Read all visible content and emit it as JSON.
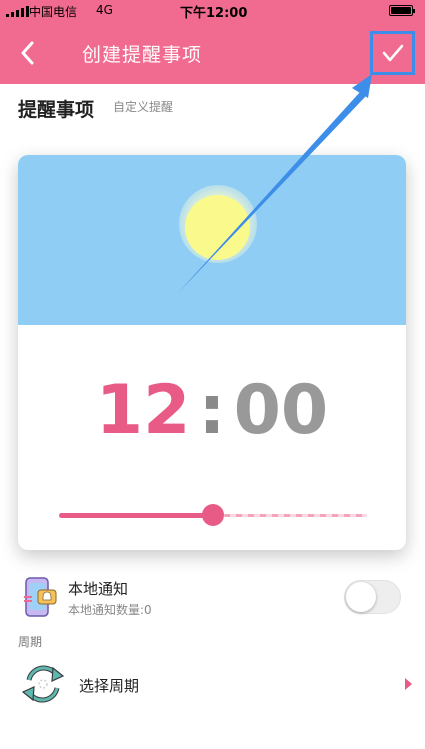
{
  "status_bar": {
    "carrier": "中国电信",
    "network": "4G",
    "time": "下午12:00"
  },
  "nav": {
    "title": "创建提醒事项",
    "back_icon": "chevron-left-icon",
    "confirm_icon": "check-icon"
  },
  "header": {
    "title": "提醒事项",
    "subtitle": "自定义提醒"
  },
  "card": {
    "hour": "12",
    "separator": ":",
    "minute": "00",
    "slider_fraction": 0.5,
    "accent_color": "#e95b87",
    "sky_color": "#90cdf4"
  },
  "notification": {
    "title": "本地通知",
    "subtitle": "本地通知数量:0",
    "enabled": false
  },
  "period": {
    "section_label": "周期",
    "select_label": "选择周期"
  },
  "colors": {
    "brand": "#f06b8f",
    "highlight": "#3d8ee8"
  }
}
